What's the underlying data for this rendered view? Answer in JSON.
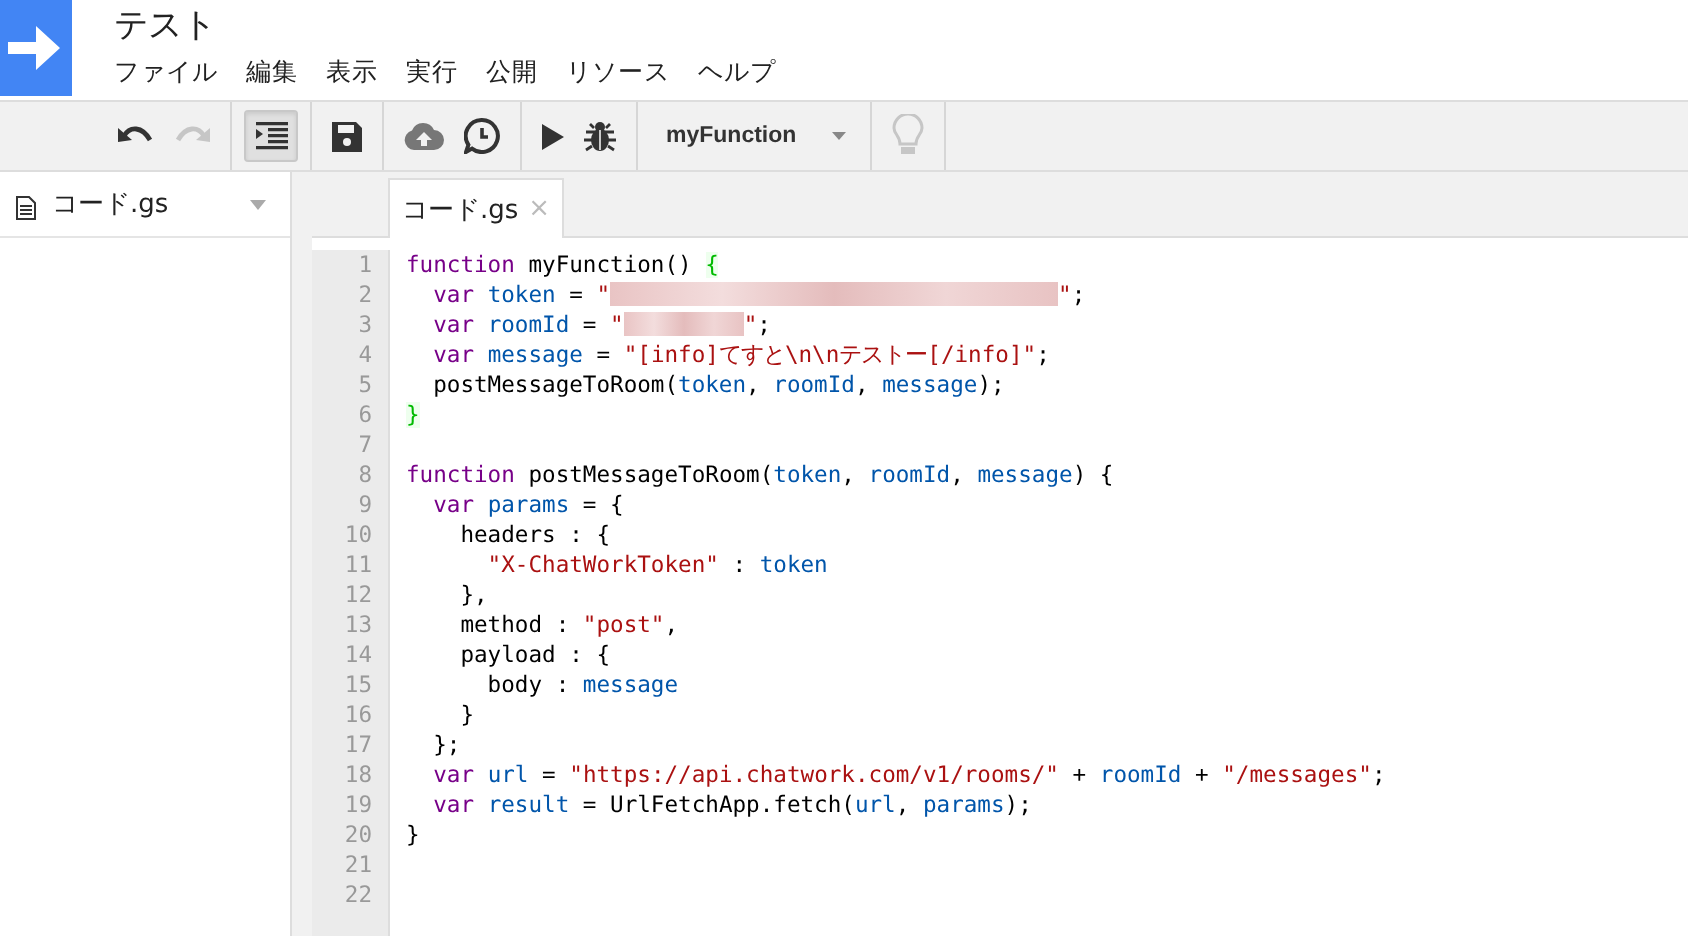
{
  "window": {
    "title": "テスト"
  },
  "menu": [
    "ファイル",
    "編集",
    "表示",
    "実行",
    "公開",
    "リソース",
    "ヘルプ"
  ],
  "toolbar": {
    "undo": {
      "disabled": false
    },
    "redo": {
      "disabled": true
    },
    "indent": {
      "pressed": true
    },
    "function_select": {
      "value": "myFunction"
    },
    "hint": {
      "disabled": true
    }
  },
  "sidebar": {
    "files": [
      {
        "name": "コード.gs"
      }
    ]
  },
  "tabs": [
    {
      "label": "コード.gs",
      "selected": true,
      "close": "×"
    }
  ],
  "editor": {
    "lines": [
      {
        "n": "1",
        "tokens": [
          {
            "kind": "keyword",
            "text": "function"
          },
          {
            "kind": "plain",
            "text": " myFunction() "
          },
          {
            "kind": "bracket",
            "text": "{"
          }
        ]
      },
      {
        "n": "2",
        "tokens": [
          {
            "kind": "keyword",
            "text": "  var"
          },
          {
            "kind": "variable",
            "text": " token"
          },
          {
            "kind": "plain",
            "text": " = "
          },
          {
            "kind": "string",
            "text": "\""
          },
          {
            "kind": "redacted-long"
          },
          {
            "kind": "string",
            "text": "\""
          },
          {
            "kind": "plain",
            "text": ";"
          }
        ]
      },
      {
        "n": "3",
        "tokens": [
          {
            "kind": "keyword",
            "text": "  var"
          },
          {
            "kind": "variable",
            "text": " roomId"
          },
          {
            "kind": "plain",
            "text": " = "
          },
          {
            "kind": "string",
            "text": "\""
          },
          {
            "kind": "redacted-short"
          },
          {
            "kind": "string",
            "text": "\""
          },
          {
            "kind": "plain",
            "text": ";"
          }
        ]
      },
      {
        "n": "4",
        "tokens": [
          {
            "kind": "keyword",
            "text": "  var"
          },
          {
            "kind": "variable",
            "text": " message"
          },
          {
            "kind": "plain",
            "text": " = "
          },
          {
            "kind": "string",
            "text": "\"[info]てすと\\n\\nテストー[/info]\""
          },
          {
            "kind": "plain",
            "text": ";"
          }
        ]
      },
      {
        "n": "5",
        "tokens": [
          {
            "kind": "plain",
            "text": "  postMessageToRoom("
          },
          {
            "kind": "variable",
            "text": "token"
          },
          {
            "kind": "plain",
            "text": ", "
          },
          {
            "kind": "variable",
            "text": "roomId"
          },
          {
            "kind": "plain",
            "text": ", "
          },
          {
            "kind": "variable",
            "text": "message"
          },
          {
            "kind": "plain",
            "text": ");"
          }
        ]
      },
      {
        "n": "6",
        "tokens": [
          {
            "kind": "bracket",
            "text": "}"
          }
        ]
      },
      {
        "n": "7"
      },
      {
        "n": "8",
        "tokens": [
          {
            "kind": "keyword",
            "text": "function"
          },
          {
            "kind": "plain",
            "text": " postMessageToRoom("
          },
          {
            "kind": "variable",
            "text": "token"
          },
          {
            "kind": "plain",
            "text": ", "
          },
          {
            "kind": "variable",
            "text": "roomId"
          },
          {
            "kind": "plain",
            "text": ", "
          },
          {
            "kind": "variable",
            "text": "message"
          },
          {
            "kind": "plain",
            "text": ") {"
          }
        ]
      },
      {
        "n": "9",
        "tokens": [
          {
            "kind": "keyword",
            "text": "  var"
          },
          {
            "kind": "variable",
            "text": " params"
          },
          {
            "kind": "plain",
            "text": " = {"
          }
        ]
      },
      {
        "n": "10",
        "tokens": [
          {
            "kind": "plain",
            "text": "    headers : {"
          }
        ]
      },
      {
        "n": "11",
        "tokens": [
          {
            "kind": "string",
            "text": "      \"X-ChatWorkToken\""
          },
          {
            "kind": "plain",
            "text": " : "
          },
          {
            "kind": "variable",
            "text": "token"
          }
        ]
      },
      {
        "n": "12",
        "tokens": [
          {
            "kind": "plain",
            "text": "    },"
          }
        ]
      },
      {
        "n": "13",
        "tokens": [
          {
            "kind": "plain",
            "text": "    method : "
          },
          {
            "kind": "string",
            "text": "\"post\""
          },
          {
            "kind": "plain",
            "text": ","
          }
        ]
      },
      {
        "n": "14",
        "tokens": [
          {
            "kind": "plain",
            "text": "    payload : {"
          }
        ]
      },
      {
        "n": "15",
        "tokens": [
          {
            "kind": "plain",
            "text": "      body : "
          },
          {
            "kind": "variable",
            "text": "message"
          }
        ]
      },
      {
        "n": "16",
        "tokens": [
          {
            "kind": "plain",
            "text": "    }"
          }
        ]
      },
      {
        "n": "17",
        "tokens": [
          {
            "kind": "plain",
            "text": "  };"
          }
        ]
      },
      {
        "n": "18",
        "tokens": [
          {
            "kind": "keyword",
            "text": "  var"
          },
          {
            "kind": "variable",
            "text": " url"
          },
          {
            "kind": "plain",
            "text": " = "
          },
          {
            "kind": "string",
            "text": "\"https://api.chatwork.com/v1/rooms/\""
          },
          {
            "kind": "plain",
            "text": " + "
          },
          {
            "kind": "variable",
            "text": "roomId"
          },
          {
            "kind": "plain",
            "text": " + "
          },
          {
            "kind": "string",
            "text": "\"/messages\""
          },
          {
            "kind": "plain",
            "text": ";"
          }
        ]
      },
      {
        "n": "19",
        "tokens": [
          {
            "kind": "keyword",
            "text": "  var"
          },
          {
            "kind": "variable",
            "text": " result"
          },
          {
            "kind": "plain",
            "text": " = UrlFetchApp.fetch("
          },
          {
            "kind": "variable",
            "text": "url"
          },
          {
            "kind": "plain",
            "text": ", "
          },
          {
            "kind": "variable",
            "text": "params"
          },
          {
            "kind": "plain",
            "text": ");"
          }
        ]
      },
      {
        "n": "20",
        "tokens": [
          {
            "kind": "plain",
            "text": "}"
          }
        ]
      },
      {
        "n": "21"
      },
      {
        "n": "22"
      }
    ]
  }
}
